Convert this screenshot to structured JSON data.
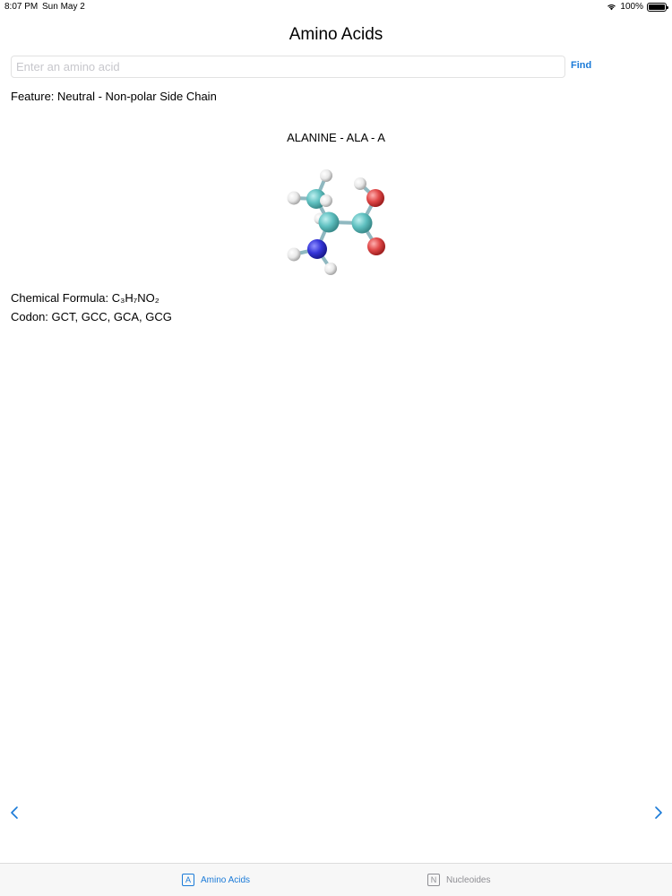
{
  "status_bar": {
    "time": "8:07 PM",
    "date": "Sun May 2",
    "battery": "100%",
    "battery_level": 1.0
  },
  "header": {
    "title": "Amino Acids"
  },
  "search": {
    "placeholder": "Enter an amino acid",
    "value": "",
    "find_label": "Find"
  },
  "feature": {
    "label": "Feature:",
    "value": "Neutral - Non-polar Side Chain"
  },
  "amino_acid": {
    "name_line": "ALANINE - ALA - A",
    "formula_label": "Chemical Formula:",
    "formula": "C₃H₇NO₂",
    "codon_label": "Codon:",
    "codons": "GCT, GCC, GCA, GCG"
  },
  "navigation": {
    "prev_icon": "chevron-left-icon",
    "next_icon": "chevron-right-icon"
  },
  "tabs": [
    {
      "label": "Amino Acids",
      "icon_letter": "A",
      "selected": true
    },
    {
      "label": "Nucleoides",
      "icon_letter": "N",
      "selected": false
    }
  ],
  "colors": {
    "accent": "#1a7ad8",
    "inactive": "#8e8e93",
    "carbon": "#5fc0c0",
    "oxygen": "#e04848",
    "nitrogen": "#3535d8",
    "hydrogen": "#e8e8e8"
  }
}
